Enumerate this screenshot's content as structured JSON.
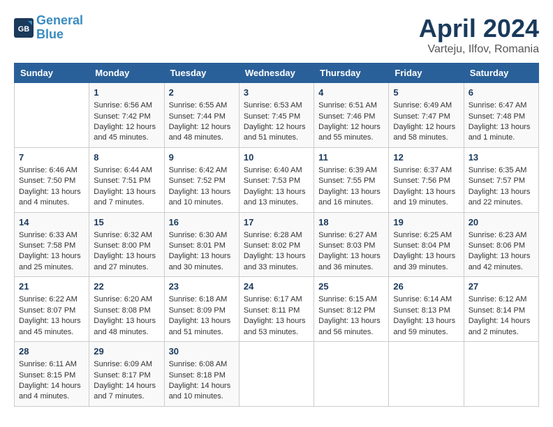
{
  "header": {
    "logo_line1": "General",
    "logo_line2": "Blue",
    "month": "April 2024",
    "location": "Varteju, Ilfov, Romania"
  },
  "weekdays": [
    "Sunday",
    "Monday",
    "Tuesday",
    "Wednesday",
    "Thursday",
    "Friday",
    "Saturday"
  ],
  "weeks": [
    [
      {
        "day": "",
        "info": ""
      },
      {
        "day": "1",
        "info": "Sunrise: 6:56 AM\nSunset: 7:42 PM\nDaylight: 12 hours\nand 45 minutes."
      },
      {
        "day": "2",
        "info": "Sunrise: 6:55 AM\nSunset: 7:44 PM\nDaylight: 12 hours\nand 48 minutes."
      },
      {
        "day": "3",
        "info": "Sunrise: 6:53 AM\nSunset: 7:45 PM\nDaylight: 12 hours\nand 51 minutes."
      },
      {
        "day": "4",
        "info": "Sunrise: 6:51 AM\nSunset: 7:46 PM\nDaylight: 12 hours\nand 55 minutes."
      },
      {
        "day": "5",
        "info": "Sunrise: 6:49 AM\nSunset: 7:47 PM\nDaylight: 12 hours\nand 58 minutes."
      },
      {
        "day": "6",
        "info": "Sunrise: 6:47 AM\nSunset: 7:48 PM\nDaylight: 13 hours\nand 1 minute."
      }
    ],
    [
      {
        "day": "7",
        "info": "Sunrise: 6:46 AM\nSunset: 7:50 PM\nDaylight: 13 hours\nand 4 minutes."
      },
      {
        "day": "8",
        "info": "Sunrise: 6:44 AM\nSunset: 7:51 PM\nDaylight: 13 hours\nand 7 minutes."
      },
      {
        "day": "9",
        "info": "Sunrise: 6:42 AM\nSunset: 7:52 PM\nDaylight: 13 hours\nand 10 minutes."
      },
      {
        "day": "10",
        "info": "Sunrise: 6:40 AM\nSunset: 7:53 PM\nDaylight: 13 hours\nand 13 minutes."
      },
      {
        "day": "11",
        "info": "Sunrise: 6:39 AM\nSunset: 7:55 PM\nDaylight: 13 hours\nand 16 minutes."
      },
      {
        "day": "12",
        "info": "Sunrise: 6:37 AM\nSunset: 7:56 PM\nDaylight: 13 hours\nand 19 minutes."
      },
      {
        "day": "13",
        "info": "Sunrise: 6:35 AM\nSunset: 7:57 PM\nDaylight: 13 hours\nand 22 minutes."
      }
    ],
    [
      {
        "day": "14",
        "info": "Sunrise: 6:33 AM\nSunset: 7:58 PM\nDaylight: 13 hours\nand 25 minutes."
      },
      {
        "day": "15",
        "info": "Sunrise: 6:32 AM\nSunset: 8:00 PM\nDaylight: 13 hours\nand 27 minutes."
      },
      {
        "day": "16",
        "info": "Sunrise: 6:30 AM\nSunset: 8:01 PM\nDaylight: 13 hours\nand 30 minutes."
      },
      {
        "day": "17",
        "info": "Sunrise: 6:28 AM\nSunset: 8:02 PM\nDaylight: 13 hours\nand 33 minutes."
      },
      {
        "day": "18",
        "info": "Sunrise: 6:27 AM\nSunset: 8:03 PM\nDaylight: 13 hours\nand 36 minutes."
      },
      {
        "day": "19",
        "info": "Sunrise: 6:25 AM\nSunset: 8:04 PM\nDaylight: 13 hours\nand 39 minutes."
      },
      {
        "day": "20",
        "info": "Sunrise: 6:23 AM\nSunset: 8:06 PM\nDaylight: 13 hours\nand 42 minutes."
      }
    ],
    [
      {
        "day": "21",
        "info": "Sunrise: 6:22 AM\nSunset: 8:07 PM\nDaylight: 13 hours\nand 45 minutes."
      },
      {
        "day": "22",
        "info": "Sunrise: 6:20 AM\nSunset: 8:08 PM\nDaylight: 13 hours\nand 48 minutes."
      },
      {
        "day": "23",
        "info": "Sunrise: 6:18 AM\nSunset: 8:09 PM\nDaylight: 13 hours\nand 51 minutes."
      },
      {
        "day": "24",
        "info": "Sunrise: 6:17 AM\nSunset: 8:11 PM\nDaylight: 13 hours\nand 53 minutes."
      },
      {
        "day": "25",
        "info": "Sunrise: 6:15 AM\nSunset: 8:12 PM\nDaylight: 13 hours\nand 56 minutes."
      },
      {
        "day": "26",
        "info": "Sunrise: 6:14 AM\nSunset: 8:13 PM\nDaylight: 13 hours\nand 59 minutes."
      },
      {
        "day": "27",
        "info": "Sunrise: 6:12 AM\nSunset: 8:14 PM\nDaylight: 14 hours\nand 2 minutes."
      }
    ],
    [
      {
        "day": "28",
        "info": "Sunrise: 6:11 AM\nSunset: 8:15 PM\nDaylight: 14 hours\nand 4 minutes."
      },
      {
        "day": "29",
        "info": "Sunrise: 6:09 AM\nSunset: 8:17 PM\nDaylight: 14 hours\nand 7 minutes."
      },
      {
        "day": "30",
        "info": "Sunrise: 6:08 AM\nSunset: 8:18 PM\nDaylight: 14 hours\nand 10 minutes."
      },
      {
        "day": "",
        "info": ""
      },
      {
        "day": "",
        "info": ""
      },
      {
        "day": "",
        "info": ""
      },
      {
        "day": "",
        "info": ""
      }
    ]
  ]
}
